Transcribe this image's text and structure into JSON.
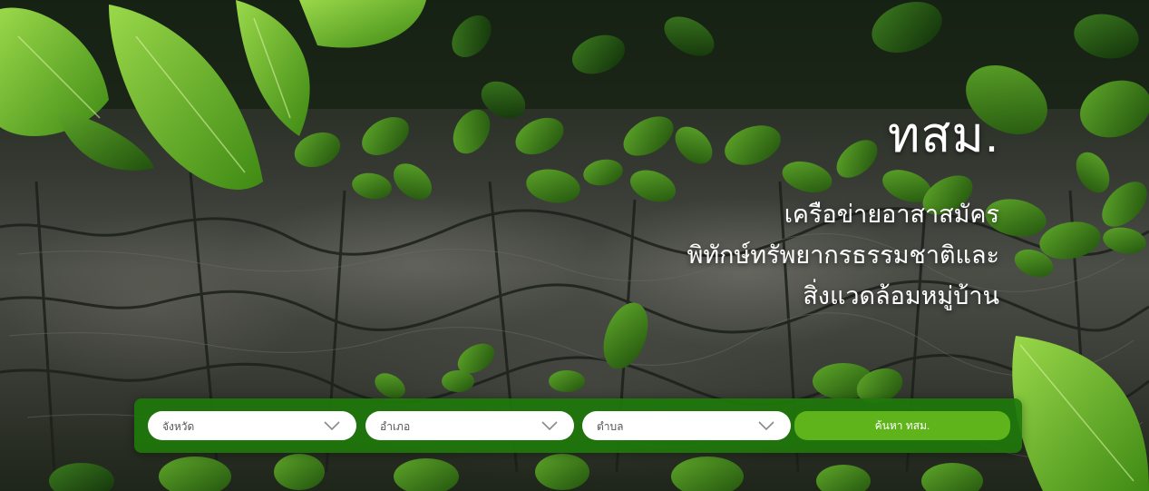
{
  "hero": {
    "brand": "ทสม.",
    "subtitle_lines": [
      "เครือข่ายอาสาสมัคร",
      "พิทักษ์ทรัพยากรธรรมชาติและ",
      "สิ่งแวดล้อมหมู่บ้าน"
    ]
  },
  "search": {
    "province_placeholder": "จังหวัด",
    "district_placeholder": "อำเภอ",
    "subdistrict_placeholder": "ตำบล",
    "button_label": "ค้นหา ทสม."
  },
  "colors": {
    "search_bar_bg": "#1e780a",
    "button_bg": "#5fb31b",
    "text_light": "#ffffff"
  },
  "icons": {
    "dropdown": "chevron-down-icon"
  }
}
